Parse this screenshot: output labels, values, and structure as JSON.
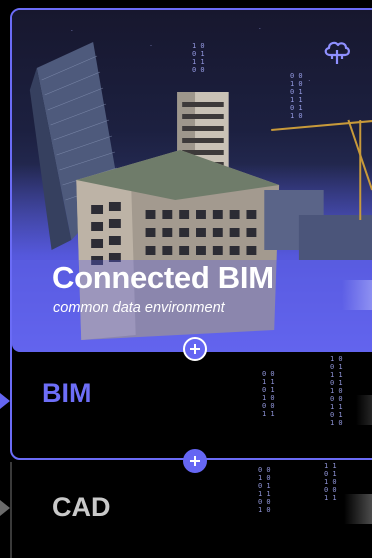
{
  "hero": {
    "title": "Connected BIM",
    "subtitle": "common data environment",
    "cloud_icon": "cloud-network-icon"
  },
  "sections": {
    "bim_label": "BIM",
    "cad_label": "CAD"
  },
  "icons": {
    "plus": "plus-icon",
    "arrow": "play-arrow-icon"
  },
  "colors": {
    "accent": "#6566f3",
    "accent_border": "#6b6cf6",
    "bim_text": "#6d6ef7",
    "cad_text": "#c9c9c9",
    "background": "#000000"
  }
}
